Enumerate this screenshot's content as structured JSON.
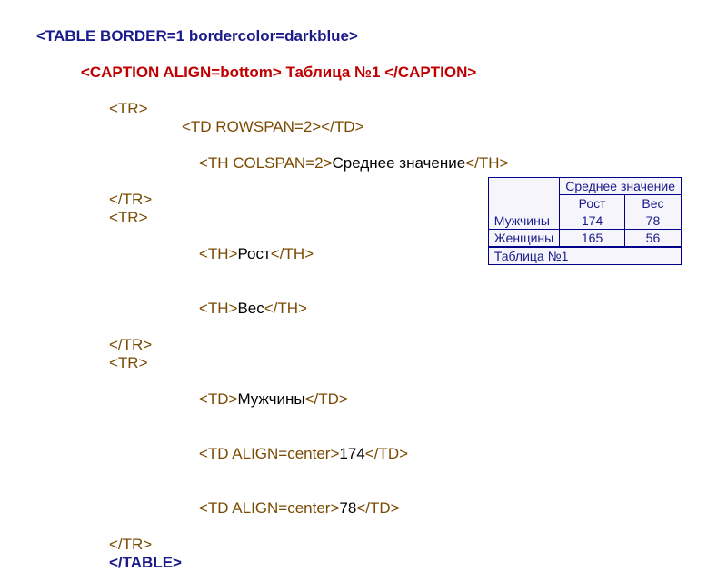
{
  "code": {
    "l1": "<TABLE BORDER=1 bordercolor=darkblue>",
    "l2a": "<CAPTION ALIGN=bottom>",
    "l2b": " Таблица №1 ",
    "l2c": "</CAPTION>",
    "l3": "<TR>",
    "l4": "<TD ROWSPAN=2></TD>",
    "l5a": "<TH COLSPAN=2>",
    "l5b": "Среднее значение",
    "l5c": "</TH>",
    "l6": "</TR>",
    "l7": "<TR>",
    "l8a": "<TH>",
    "l8b": "Рост",
    "l8c": "</TH>",
    "l9a": "<TH>",
    "l9b": "Вес",
    "l9c": "</TH>",
    "l10": "</TR>",
    "l11": "<TR>",
    "l12a": "<TD>",
    "l12b": "Мужчины",
    "l12c": "</TD>",
    "l13a": "<TD ALIGN=center>",
    "l13b": "174",
    "l13c": "</TD>",
    "l14a": "<TD ALIGN=center>",
    "l14b": "78",
    "l14c": "</TD>",
    "l15": "</TR>",
    "l16": "</TABLE>"
  },
  "table": {
    "caption": "Таблица №1",
    "header_span": "Среднее значение",
    "col1": "Рост",
    "col2": "Вес",
    "rows": [
      {
        "label": "Мужчины",
        "v1": "174",
        "v2": "78"
      },
      {
        "label": "Женщины",
        "v1": "165",
        "v2": "56"
      }
    ]
  }
}
